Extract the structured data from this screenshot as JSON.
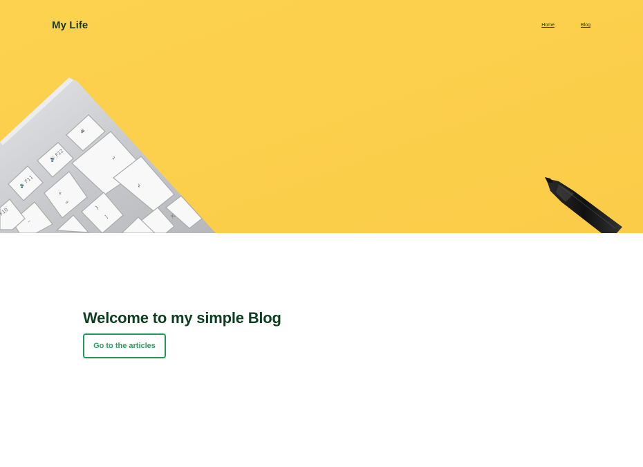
{
  "header": {
    "brand": "My Life",
    "nav": [
      {
        "label": "Home"
      },
      {
        "label": "Blog"
      }
    ]
  },
  "hero": {
    "image": "yellow desk with white keyboard and black pen",
    "background_color": "#fcd04d",
    "keyboard_keys": [
      "F10",
      "F11",
      "F12",
      "-",
      "+",
      "=",
      "_",
      "{",
      "}",
      "[",
      "]"
    ]
  },
  "main": {
    "heading": "Welcome to my simple Blog",
    "cta_label": "Go to the articles",
    "heading_color": "#0f3d22",
    "accent_color": "#1f9a55"
  }
}
